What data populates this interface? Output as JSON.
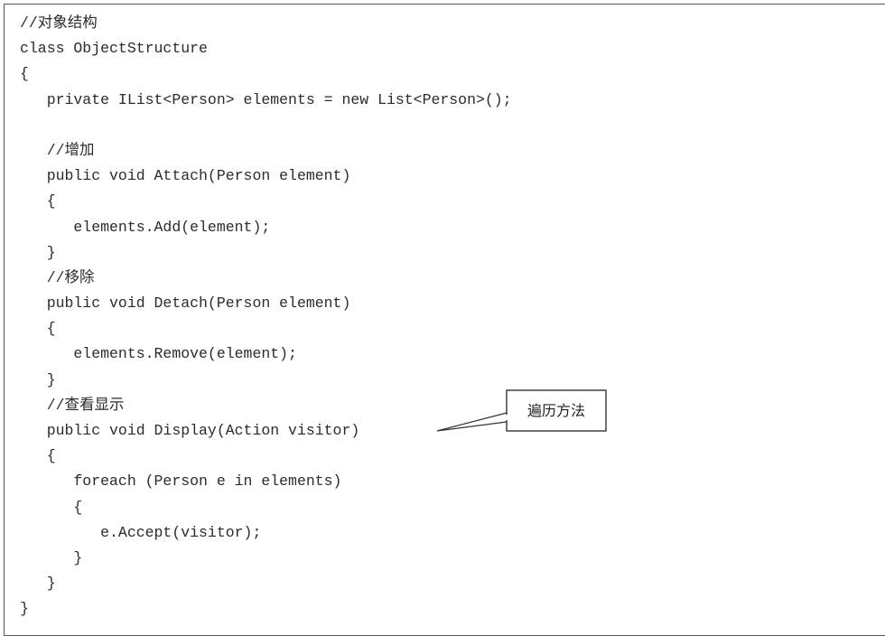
{
  "code_lines": [
    "//对象结构",
    "class ObjectStructure",
    "{",
    "   private IList<Person> elements = new List<Person>();",
    "",
    "   //增加",
    "   public void Attach(Person element)",
    "   {",
    "      elements.Add(element);",
    "   }",
    "   //移除",
    "   public void Detach(Person element)",
    "   {",
    "      elements.Remove(element);",
    "   }",
    "   //查看显示",
    "   public void Display(Action visitor)",
    "   {",
    "      foreach (Person e in elements)",
    "      {",
    "         e.Accept(visitor);",
    "      }",
    "   }",
    "}"
  ],
  "callout": {
    "label": "遍历方法"
  },
  "colors": {
    "text": "#2b2b2b",
    "border": "#555555",
    "background": "#ffffff"
  }
}
